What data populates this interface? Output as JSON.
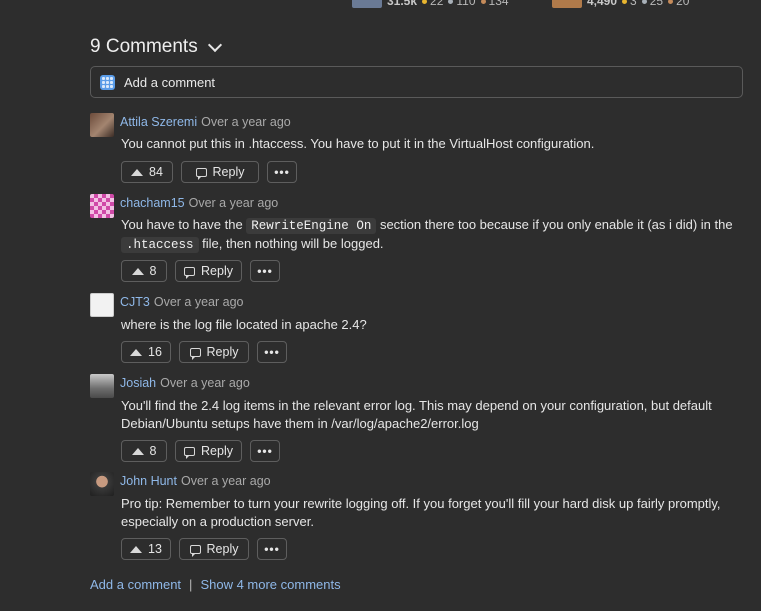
{
  "top_users": [
    {
      "rep": "31.5k",
      "gold": "22",
      "silver": "110",
      "bronze": "134"
    },
    {
      "rep": "4,490",
      "gold": "3",
      "silver": "25",
      "bronze": "20"
    }
  ],
  "header": {
    "title": "9 Comments"
  },
  "add_comment_placeholder": "Add a comment",
  "comments": [
    {
      "author": "Attila Szeremi",
      "time": "Over a year ago",
      "text": "You cannot put this in .htaccess. You have to put it in the VirtualHost configuration.",
      "votes": "84",
      "reply": "Reply",
      "more": "•••"
    },
    {
      "author": "chacham15",
      "time": "Over a year ago",
      "text_parts": [
        "You have to have the ",
        "RewriteEngine On",
        " section there too because if you only enable it (as i did) in the ",
        ".htaccess",
        " file, then nothing will be logged."
      ],
      "votes": "8",
      "reply": "Reply",
      "more": "•••"
    },
    {
      "author": "CJT3",
      "time": "Over a year ago",
      "text": "where is the log file located in apache 2.4?",
      "votes": "16",
      "reply": "Reply",
      "more": "•••"
    },
    {
      "author": "Josiah",
      "time": "Over a year ago",
      "text": "You'll find the 2.4 log items in the relevant error log. This may depend on your configuration, but default Debian/Ubuntu setups have them in /var/log/apache2/error.log",
      "votes": "8",
      "reply": "Reply",
      "more": "•••"
    },
    {
      "author": "John Hunt",
      "time": "Over a year ago",
      "text": "Pro tip: Remember to turn your rewrite logging off. If you forget you'll fill your hard disk up fairly promptly, especially on a production server.",
      "votes": "13",
      "reply": "Reply",
      "more": "•••"
    }
  ],
  "footer": {
    "add_comment": "Add a comment",
    "separator": "|",
    "show_more": "Show 4 more comments"
  }
}
